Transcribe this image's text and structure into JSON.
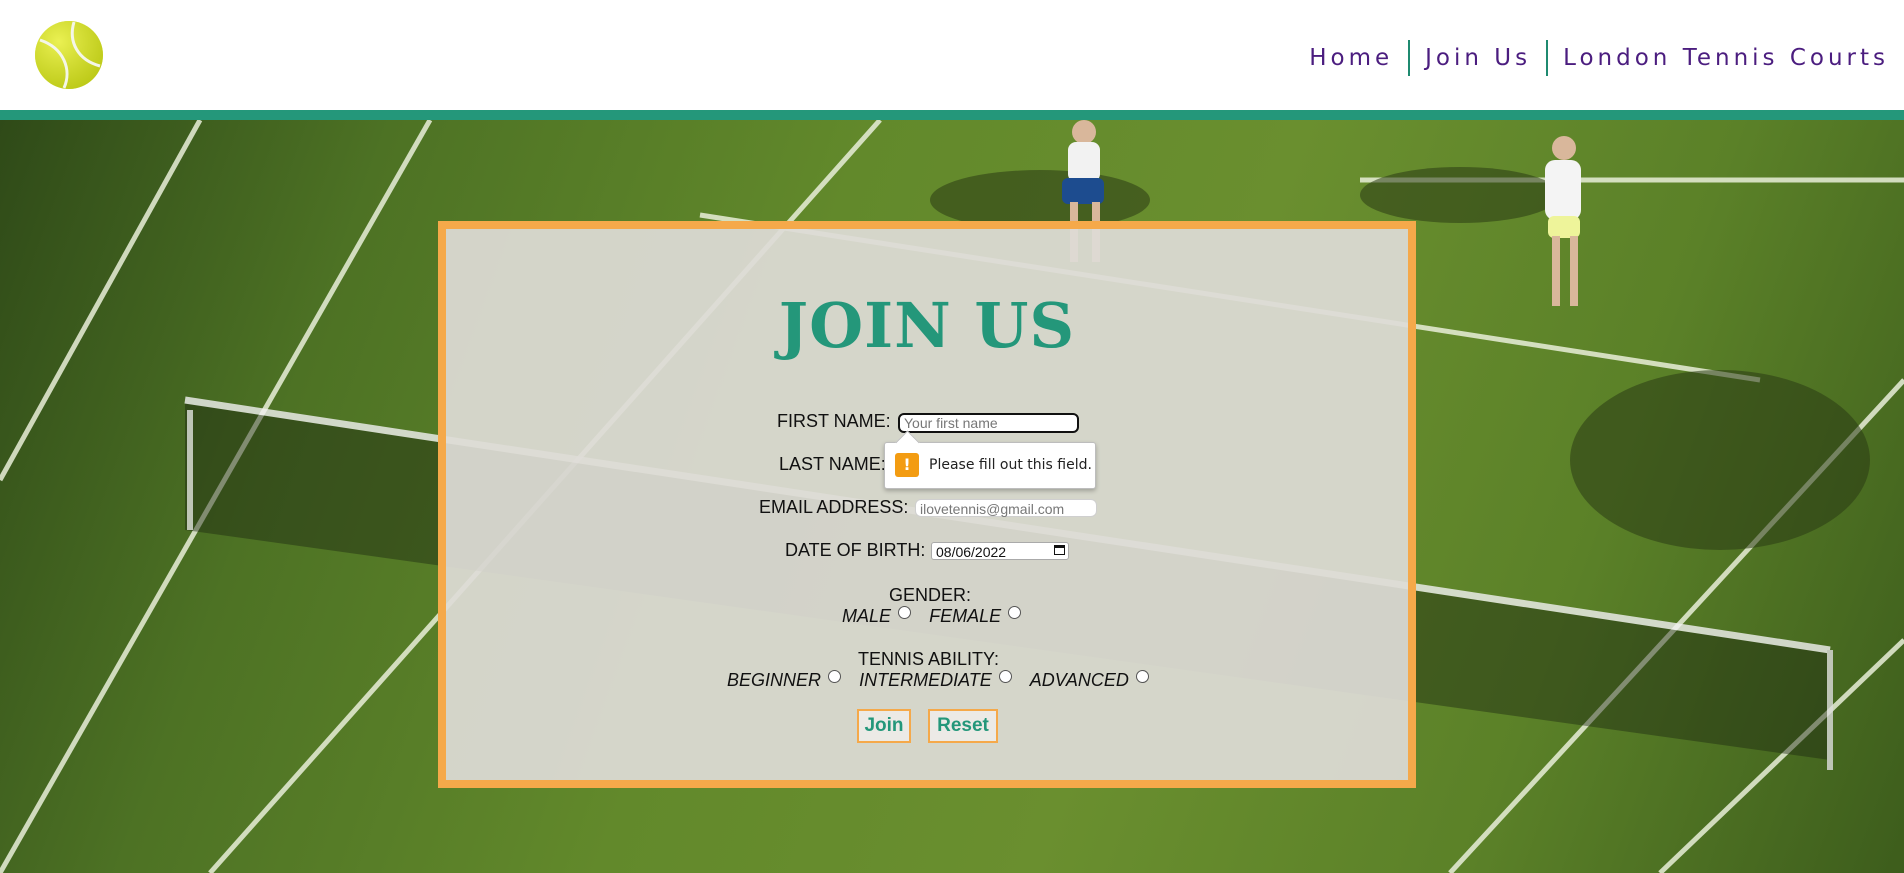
{
  "nav": {
    "items": [
      "Home",
      "Join Us",
      "London Tennis Courts"
    ]
  },
  "form": {
    "title": "JOIN US",
    "first_name_label": "FIRST NAME:",
    "first_name_placeholder": "Your first name",
    "last_name_label": "LAST NAME:",
    "email_label": "EMAIL ADDRESS:",
    "email_placeholder": "ilovetennis@gmail.com",
    "dob_label": "DATE OF BIRTH:",
    "dob_value": "08/06/2022",
    "gender_label": "GENDER:",
    "gender_options": [
      "MALE",
      "FEMALE"
    ],
    "ability_label": "TENNIS ABILITY:",
    "ability_options": [
      "BEGINNER",
      "INTERMEDIATE",
      "ADVANCED"
    ],
    "join_label": "Join",
    "reset_label": "Reset"
  },
  "validation": {
    "icon": "!",
    "message": "Please fill out this field."
  },
  "colors": {
    "accent_green": "#24977a",
    "border_orange": "#f5a94a",
    "nav_purple": "#4b1d7f",
    "warning_orange": "#f39c12"
  }
}
